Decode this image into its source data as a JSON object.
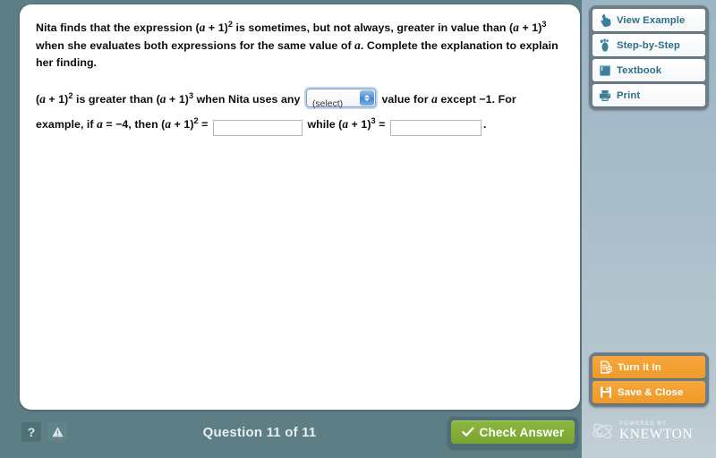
{
  "question": {
    "paragraph1": {
      "seg1": "Nita finds that the expression (",
      "var1": "a",
      "seg2": " + 1)",
      "exp1": "2",
      "seg3": " is sometimes, but not always, greater in value than (",
      "var2": "a",
      "seg4": " + 1)",
      "exp2": "3",
      "seg5": " when she evaluates both expressions for the same value of ",
      "var3": "a",
      "seg6": ". Complete the explanation to explain her finding."
    },
    "paragraph2": {
      "open1": "(",
      "var1": "a",
      "seg1": " + 1)",
      "exp1": "2",
      "seg2": " is greater than (",
      "var2": "a",
      "seg3": " + 1)",
      "exp2": "3",
      "seg4": " when Nita uses any ",
      "seg5": " value for ",
      "var3": "a",
      "seg6": " except −1. For example, if ",
      "var4": "a",
      "seg7": " = −4, then (",
      "var5": "a",
      "seg8": " + 1)",
      "exp3": "2",
      "seg9": " = ",
      "seg10": " while (",
      "var6": "a",
      "seg11": " + 1)",
      "exp4": "3",
      "seg12": " = ",
      "seg13": "."
    },
    "select": {
      "value": "(select)",
      "options": [
        "(select)"
      ]
    },
    "blank1": {
      "value": "",
      "placeholder": ""
    },
    "blank2": {
      "value": "",
      "placeholder": ""
    }
  },
  "nav_buttons": [
    {
      "label": "View Example",
      "icon": "pointing-hand-icon"
    },
    {
      "label": "Step-by-Step",
      "icon": "footprint-icon"
    },
    {
      "label": "Textbook",
      "icon": "book-icon"
    },
    {
      "label": "Print",
      "icon": "printer-icon"
    }
  ],
  "action_buttons": [
    {
      "label": "Turn it In",
      "icon": "document-upload-icon"
    },
    {
      "label": "Save & Close",
      "icon": "floppy-disk-icon"
    }
  ],
  "bottom_bar": {
    "help_label": "?",
    "warning_icon": "warning-triangle-icon",
    "counter": "Question 11 of 11",
    "check_answer_label": "Check Answer",
    "check_icon": "checkmark-icon"
  },
  "branding": {
    "powered_by": "POWERED BY",
    "name": "KNEWTON",
    "icon": "atom-icon"
  },
  "colors": {
    "background": "#5d7e85",
    "sidebar_top": "#9cb5c5",
    "sidebar_bottom": "#bac8d1",
    "panel": "#ffffff",
    "nav_label": "#2f6d86",
    "action_orange": "#f0a02e",
    "check_green": "#84b03a",
    "button_housing": "#6b7e8a"
  }
}
